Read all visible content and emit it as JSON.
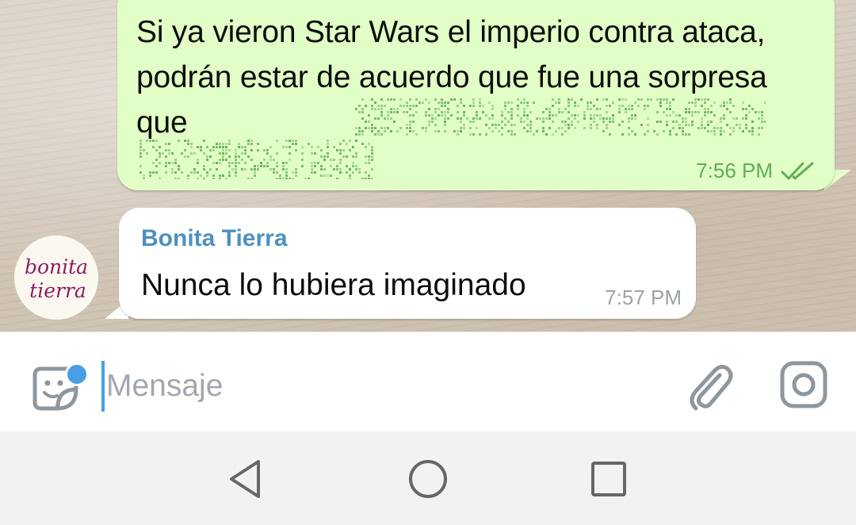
{
  "outgoing_message": {
    "text": "Si ya vieron Star Wars el imperio contra ataca, podrán estar de acuerdo que fue una sorpresa que",
    "time": "7:56 PM",
    "status_icon": "double-check-icon",
    "colors": {
      "bubble": "#e1fec6",
      "meta": "#62ac55",
      "blur": "#5aa84e"
    }
  },
  "incoming_message": {
    "sender": "Bonita Tierra",
    "text": "Nunca lo hubiera imaginado",
    "time": "7:57 PM",
    "avatar": {
      "line1": "bonita",
      "line2": "tierra",
      "color": "#8c1c64"
    },
    "colors": {
      "bubble": "#ffffff",
      "sender": "#4d90c0"
    }
  },
  "input_bar": {
    "placeholder": "Mensaje",
    "icons": [
      "emoji-sticker-icon",
      "paperclip-icon",
      "camera-icon"
    ],
    "accent": "#4a9ee6"
  },
  "nav_bar": {
    "icons": [
      "back-triangle-icon",
      "home-circle-icon",
      "recent-square-icon"
    ]
  }
}
